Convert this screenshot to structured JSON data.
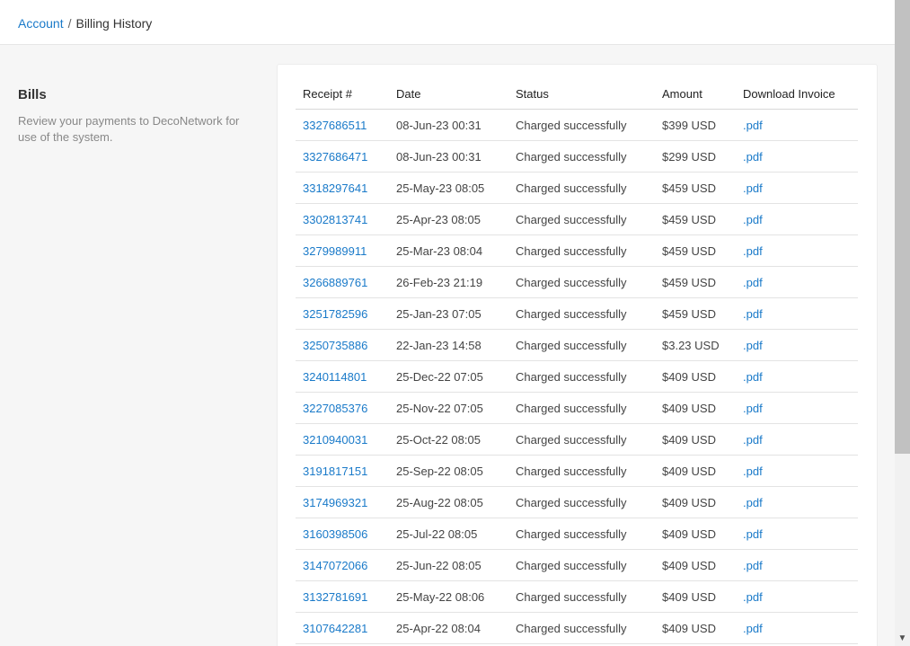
{
  "breadcrumb": {
    "parent": "Account",
    "separator": "/",
    "current": "Billing History"
  },
  "section": {
    "title": "Bills",
    "description": "Review your payments to DecoNetwork for use of the system."
  },
  "table": {
    "headers": {
      "receipt": "Receipt #",
      "date": "Date",
      "status": "Status",
      "amount": "Amount",
      "invoice": "Download Invoice"
    },
    "rows": [
      {
        "receipt": "3327686511",
        "date": "08-Jun-23 00:31",
        "status": "Charged successfully",
        "amount": "$399 USD",
        "invoice": ".pdf"
      },
      {
        "receipt": "3327686471",
        "date": "08-Jun-23 00:31",
        "status": "Charged successfully",
        "amount": "$299 USD",
        "invoice": ".pdf"
      },
      {
        "receipt": "3318297641",
        "date": "25-May-23 08:05",
        "status": "Charged successfully",
        "amount": "$459 USD",
        "invoice": ".pdf"
      },
      {
        "receipt": "3302813741",
        "date": "25-Apr-23 08:05",
        "status": "Charged successfully",
        "amount": "$459 USD",
        "invoice": ".pdf"
      },
      {
        "receipt": "3279989911",
        "date": "25-Mar-23 08:04",
        "status": "Charged successfully",
        "amount": "$459 USD",
        "invoice": ".pdf"
      },
      {
        "receipt": "3266889761",
        "date": "26-Feb-23 21:19",
        "status": "Charged successfully",
        "amount": "$459 USD",
        "invoice": ".pdf"
      },
      {
        "receipt": "3251782596",
        "date": "25-Jan-23 07:05",
        "status": "Charged successfully",
        "amount": "$459 USD",
        "invoice": ".pdf"
      },
      {
        "receipt": "3250735886",
        "date": "22-Jan-23 14:58",
        "status": "Charged successfully",
        "amount": "$3.23 USD",
        "invoice": ".pdf"
      },
      {
        "receipt": "3240114801",
        "date": "25-Dec-22 07:05",
        "status": "Charged successfully",
        "amount": "$409 USD",
        "invoice": ".pdf"
      },
      {
        "receipt": "3227085376",
        "date": "25-Nov-22 07:05",
        "status": "Charged successfully",
        "amount": "$409 USD",
        "invoice": ".pdf"
      },
      {
        "receipt": "3210940031",
        "date": "25-Oct-22 08:05",
        "status": "Charged successfully",
        "amount": "$409 USD",
        "invoice": ".pdf"
      },
      {
        "receipt": "3191817151",
        "date": "25-Sep-22 08:05",
        "status": "Charged successfully",
        "amount": "$409 USD",
        "invoice": ".pdf"
      },
      {
        "receipt": "3174969321",
        "date": "25-Aug-22 08:05",
        "status": "Charged successfully",
        "amount": "$409 USD",
        "invoice": ".pdf"
      },
      {
        "receipt": "3160398506",
        "date": "25-Jul-22 08:05",
        "status": "Charged successfully",
        "amount": "$409 USD",
        "invoice": ".pdf"
      },
      {
        "receipt": "3147072066",
        "date": "25-Jun-22 08:05",
        "status": "Charged successfully",
        "amount": "$409 USD",
        "invoice": ".pdf"
      },
      {
        "receipt": "3132781691",
        "date": "25-May-22 08:06",
        "status": "Charged successfully",
        "amount": "$409 USD",
        "invoice": ".pdf"
      },
      {
        "receipt": "3107642281",
        "date": "25-Apr-22 08:04",
        "status": "Charged successfully",
        "amount": "$409 USD",
        "invoice": ".pdf"
      }
    ]
  },
  "scrollbar": {
    "arrow_icon": "chevron-down-icon"
  },
  "colors": {
    "link": "#1a7ac9",
    "page_background": "#f6f6f6",
    "card_background": "#ffffff"
  }
}
